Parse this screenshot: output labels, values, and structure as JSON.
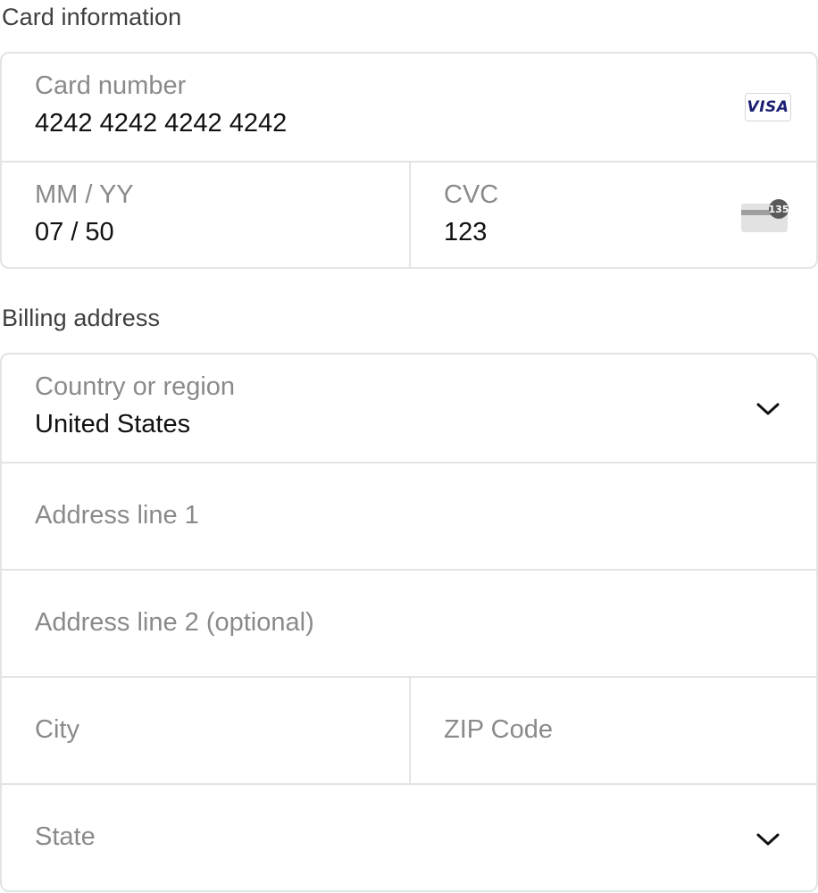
{
  "card_section": {
    "title": "Card information",
    "card_number": {
      "label": "Card number",
      "value": "4242 4242 4242 4242",
      "brand": "VISA"
    },
    "expiry": {
      "label": "MM / YY",
      "value": "07 / 50"
    },
    "cvc": {
      "label": "CVC",
      "value": "123",
      "icon_hint": "135"
    }
  },
  "billing_section": {
    "title": "Billing address",
    "country": {
      "label": "Country or region",
      "value": "United States"
    },
    "address_line1": {
      "placeholder": "Address line 1"
    },
    "address_line2": {
      "placeholder": "Address line 2 (optional)"
    },
    "city": {
      "placeholder": "City"
    },
    "zip": {
      "placeholder": "ZIP Code"
    },
    "state": {
      "placeholder": "State"
    }
  },
  "icons": {
    "card_brand": "visa-icon",
    "cvc": "card-cvc-icon",
    "dropdown": "chevron-down-icon"
  },
  "colors": {
    "border": "#e3e3e3",
    "label": "#8a8a8a",
    "text": "#111111",
    "visa": "#1a1f71"
  }
}
